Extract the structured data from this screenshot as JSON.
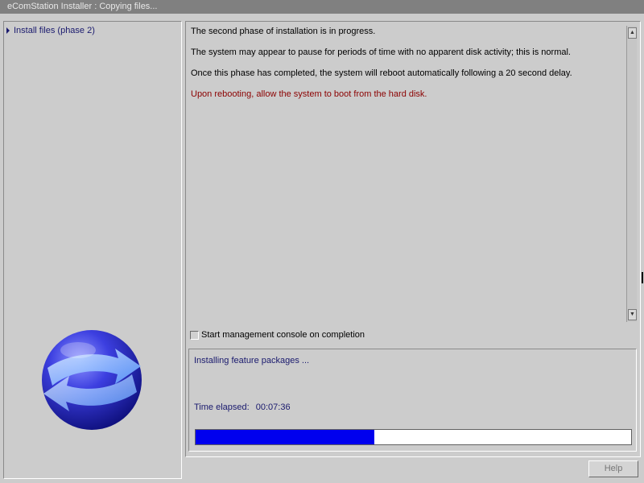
{
  "window": {
    "title": "eComStation Installer : Copying files..."
  },
  "sidebar": {
    "steps": [
      {
        "label": "Install files (phase 2)",
        "icon": "triangle-right-icon"
      }
    ],
    "logo": "ecomstation-globe-logo"
  },
  "info": {
    "lines": [
      "The second phase of installation is in progress.",
      "The system may appear to pause for periods of time with no apparent disk activity; this is normal.",
      "Once this phase has completed, the system will reboot automatically following a 20 second delay.",
      "Upon rebooting, allow the system to boot from the hard disk."
    ],
    "warning_color": "#8b0000"
  },
  "options": {
    "console_checkbox_label": "Start management console on completion",
    "console_checkbox_checked": false
  },
  "status": {
    "message": "Installing feature packages ...",
    "elapsed_label": "Time elapsed:",
    "elapsed_value": "00:07:36",
    "progress_percent": 41,
    "progress_color": "#0000ee"
  },
  "buttons": {
    "help_label": "Help"
  }
}
